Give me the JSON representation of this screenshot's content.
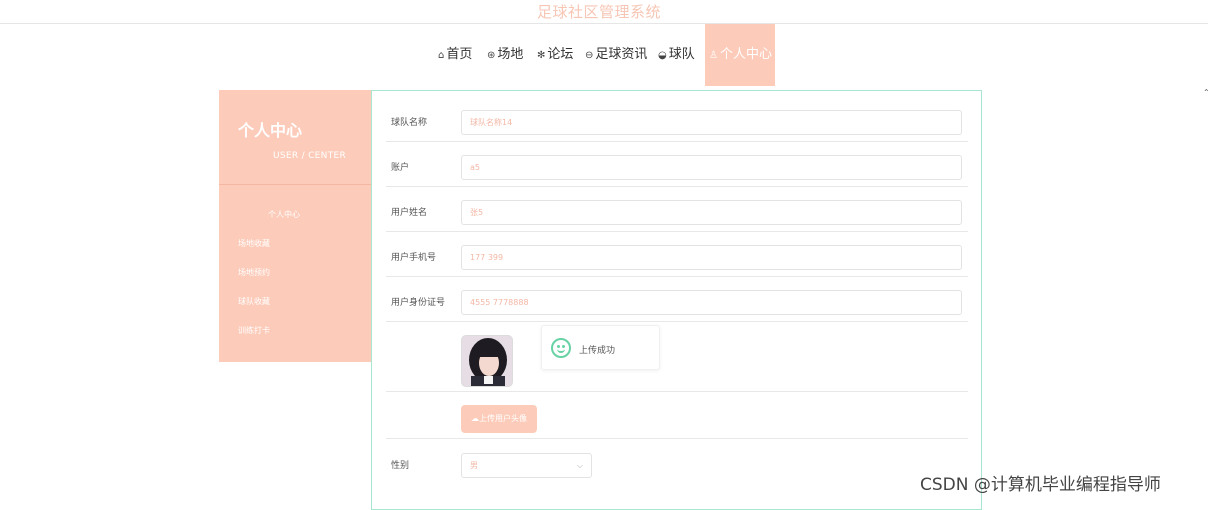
{
  "site": {
    "title": "足球社区管理系统"
  },
  "nav": [
    {
      "icon": "⌂",
      "label": "首页"
    },
    {
      "icon": "⊛",
      "label": "场地"
    },
    {
      "icon": "✻",
      "label": "论坛"
    },
    {
      "icon": "⊖",
      "label": "足球资讯"
    },
    {
      "icon": "◒",
      "label": "球队"
    },
    {
      "icon": "♙",
      "label": "个人中心"
    }
  ],
  "sidebar": {
    "title": "个人中心",
    "subtitle": "USER / CENTER",
    "items": [
      "个人中心",
      "场地收藏",
      "场地预约",
      "球队收藏",
      "训练打卡"
    ]
  },
  "form": {
    "fields": [
      {
        "label": "球队名称",
        "value": "球队名称14"
      },
      {
        "label": "账户",
        "value": "a5"
      },
      {
        "label": "用户姓名",
        "value": "张5"
      },
      {
        "label": "用户手机号",
        "value": "177      399"
      },
      {
        "label": "用户身份证号",
        "value": "4555       7778888"
      }
    ],
    "toast": "上传成功",
    "upload_label": "上传用户头像",
    "gender_label": "性别",
    "gender_value": "男"
  },
  "watermark": "CSDN @计算机毕业编程指导师",
  "colors": {
    "accent": "#fdcbb9",
    "panel_border": "#a8e6d0",
    "success": "#67d2a4"
  }
}
